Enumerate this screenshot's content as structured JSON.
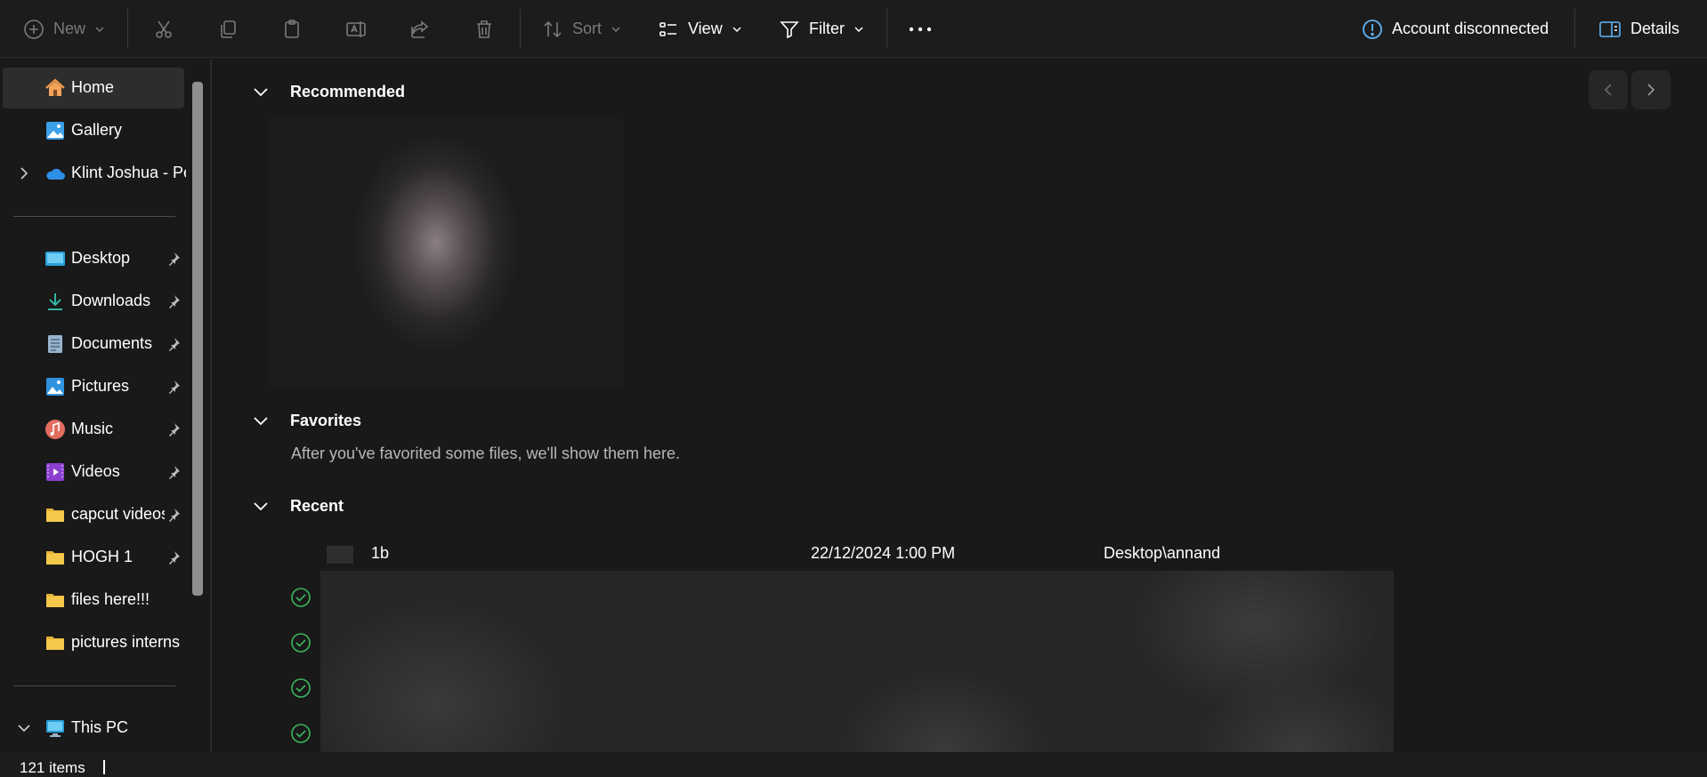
{
  "toolbar": {
    "new_label": "New",
    "sort_label": "Sort",
    "view_label": "View",
    "filter_label": "Filter",
    "account_status": "Account disconnected",
    "details_label": "Details"
  },
  "sidebar": {
    "top_items": [
      {
        "label": "Home",
        "icon": "home-icon",
        "active": true
      },
      {
        "label": "Gallery",
        "icon": "gallery-icon"
      },
      {
        "label": "Klint Joshua - Pe",
        "icon": "onedrive-cloud-icon"
      }
    ],
    "pinned_items": [
      {
        "label": "Desktop",
        "icon": "desktop-icon"
      },
      {
        "label": "Downloads",
        "icon": "downloads-icon"
      },
      {
        "label": "Documents",
        "icon": "documents-icon"
      },
      {
        "label": "Pictures",
        "icon": "pictures-icon"
      },
      {
        "label": "Music",
        "icon": "music-icon"
      },
      {
        "label": "Videos",
        "icon": "videos-icon"
      },
      {
        "label": "capcut videos",
        "icon": "folder-icon"
      },
      {
        "label": "HOGH 1",
        "icon": "folder-icon"
      },
      {
        "label": "files here!!!",
        "icon": "folder-icon"
      },
      {
        "label": "pictures interns",
        "icon": "folder-icon"
      }
    ],
    "this_pc_label": "This PC"
  },
  "main": {
    "recommended_title": "Recommended",
    "favorites_title": "Favorites",
    "favorites_empty": "After you've favorited some files, we'll show them here.",
    "recent_title": "Recent",
    "recent_rows": [
      {
        "name": "1b",
        "date": "22/12/2024 1:00 PM",
        "location": "Desktop\\annand"
      }
    ]
  },
  "status": {
    "item_count": "121 items"
  },
  "colors": {
    "background": "#191919",
    "accent_blue": "#60b3f5",
    "sync_green": "#3cb55c",
    "folder_yellow": "#f4c84b"
  }
}
